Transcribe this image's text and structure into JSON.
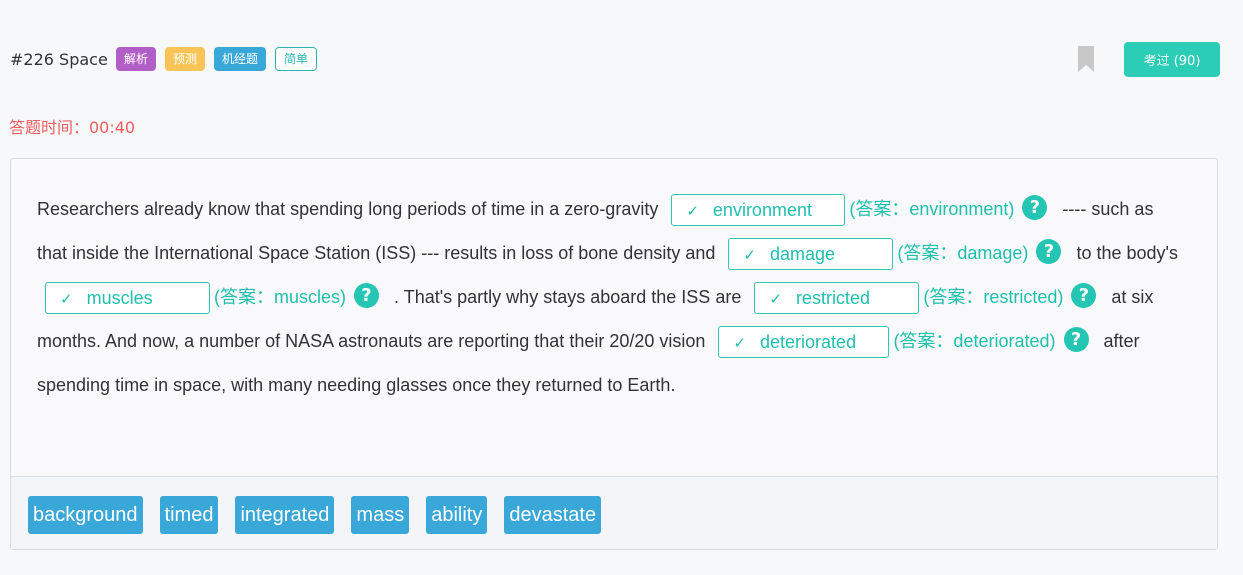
{
  "header": {
    "title": "#226 Space",
    "tags": [
      "解析",
      "预测",
      "机经题",
      "简单"
    ],
    "passed_button": "考过 (90)"
  },
  "timer": "答题时间：00:40",
  "passage": {
    "t1": "Researchers already know that spending long periods of time in a zero-gravity",
    "t2": "----",
    "t3": "such as that inside the International Space Station (ISS) --- results in loss of bone density and",
    "t4": "to the body's",
    "t5": ". That's partly why stays aboard",
    "t6": "the ISS are",
    "t7": "at six months. And now, a number of NASA astronauts are reporting that",
    "t8": "their 20/20 vision",
    "t9": "after spending time in space, with many needing glasses once",
    "t10": "they returned to Earth.",
    "blanks": [
      {
        "value": "environment",
        "answer": "(答案：environment)"
      },
      {
        "value": "damage",
        "answer": "(答案：damage)"
      },
      {
        "value": "muscles",
        "answer": "(答案：muscles)"
      },
      {
        "value": "restricted",
        "answer": "(答案：restricted)"
      },
      {
        "value": "deteriorated",
        "answer": "(答案：deteriorated)"
      }
    ],
    "check": "✓",
    "help": "?"
  },
  "word_bank": [
    "background",
    "timed",
    "integrated",
    "mass",
    "ability",
    "devastate"
  ],
  "colors": {
    "accent": "#24c5b2",
    "timer": "#ef5e5e",
    "word_chip": "#3aa7d9"
  }
}
